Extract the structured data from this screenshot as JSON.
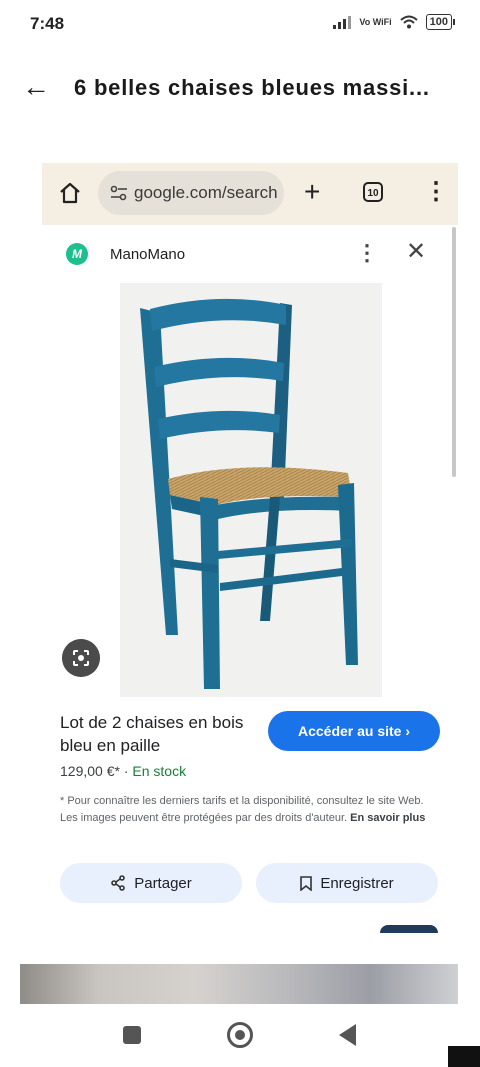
{
  "status_bar": {
    "time": "7:48",
    "network": "Vo WiFi",
    "battery": "100"
  },
  "header": {
    "back_icon": "arrow-left-icon",
    "title": "6 belles chaises bleues massi..."
  },
  "browser": {
    "url": "google.com/search",
    "tab_count": "10",
    "icons": [
      "home-icon",
      "tune-icon",
      "plus-icon",
      "tabs-icon",
      "more-vert-icon"
    ]
  },
  "result": {
    "source": "ManoMano",
    "source_logo_letter": "M",
    "product_title": "Lot de 2 chaises en bois bleu en paille",
    "price": "129,00 €*",
    "separator": "·",
    "availability": "En stock",
    "visit_button": "Accéder au site",
    "disclaimer": "* Pour connaître les derniers tarifs et la disponibilité, consultez le site Web. Les images peuvent être protégées par des droits d'auteur.",
    "learn_more": "En savoir plus",
    "share_button": "Partager",
    "save_button": "Enregistrer"
  },
  "colors": {
    "toolbar_bg": "#f5efe3",
    "accent_blue": "#1a73e8",
    "chair_blue": "#1f6f94",
    "stock_green": "#188038",
    "chip_bg": "#e8f0fe"
  }
}
